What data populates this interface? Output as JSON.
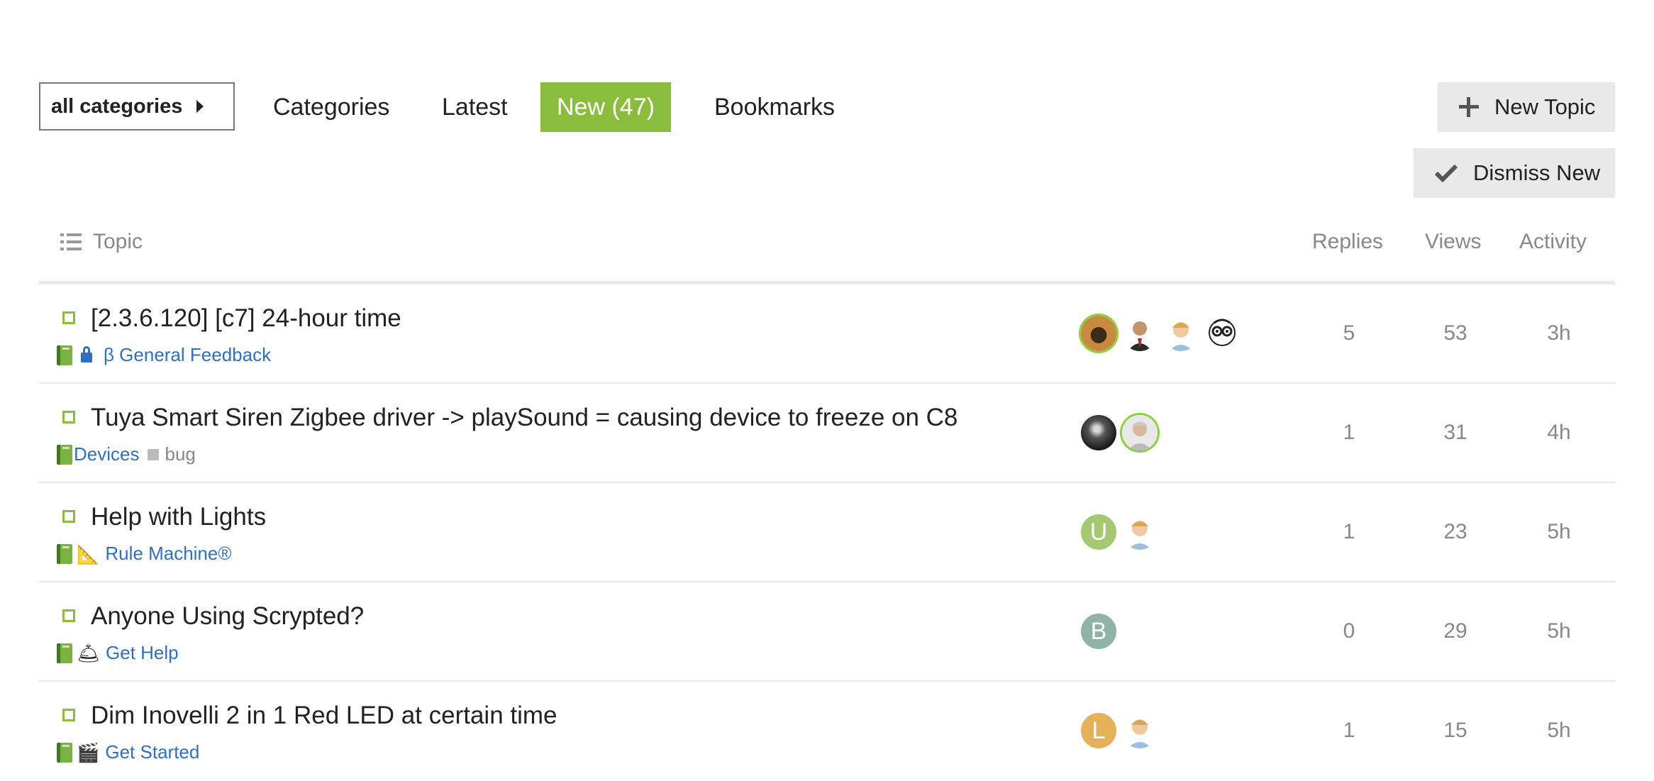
{
  "nav": {
    "dropdown_label": "all categories",
    "items": [
      {
        "label": "Categories",
        "active": false
      },
      {
        "label": "Latest",
        "active": false
      },
      {
        "label": "New (47)",
        "active": true
      },
      {
        "label": "Bookmarks",
        "active": false
      }
    ],
    "new_topic_label": "New Topic",
    "dismiss_label": "Dismiss New"
  },
  "table": {
    "headers": {
      "topic": "Topic",
      "replies": "Replies",
      "views": "Views",
      "activity": "Activity"
    },
    "rows": [
      {
        "title": "[2.3.6.120] [c7] 24-hour time",
        "category": "β General Feedback",
        "category_icon": "book",
        "locked": true,
        "tag": "",
        "replies": "5",
        "views": "53",
        "activity": "3h"
      },
      {
        "title": "Tuya Smart Siren Zigbee driver -> playSound = causing device to freeze on C8",
        "category": "Devices",
        "category_icon": "book",
        "tag": "bug",
        "replies": "1",
        "views": "31",
        "activity": "4h"
      },
      {
        "title": "Help with Lights",
        "category": "Rule Machine®",
        "category_icon": "book + triangular-ruler",
        "tag": "",
        "replies": "1",
        "views": "23",
        "activity": "5h"
      },
      {
        "title": "Anyone Using Scrypted?",
        "category": "Get Help",
        "category_icon": "book + bell",
        "tag": "",
        "replies": "0",
        "views": "29",
        "activity": "5h"
      },
      {
        "title": "Dim Inovelli 2 in 1 Red LED at certain time",
        "category": "Get Started",
        "category_icon": "book + clapper-board",
        "tag": "",
        "replies": "1",
        "views": "15",
        "activity": "5h"
      }
    ]
  },
  "avatars": {
    "letters": {
      "u": "U",
      "b": "B",
      "l": "L"
    }
  },
  "colors": {
    "accent": "#8bbd3c",
    "link": "#2f6fc4",
    "muted": "#888888",
    "avatar_u": "#a6c870",
    "avatar_b": "#8fb3a6",
    "avatar_l": "#e5b25a"
  },
  "emoji": {
    "ruler": "📐",
    "bell": "🛎",
    "clapper": "🎬"
  }
}
